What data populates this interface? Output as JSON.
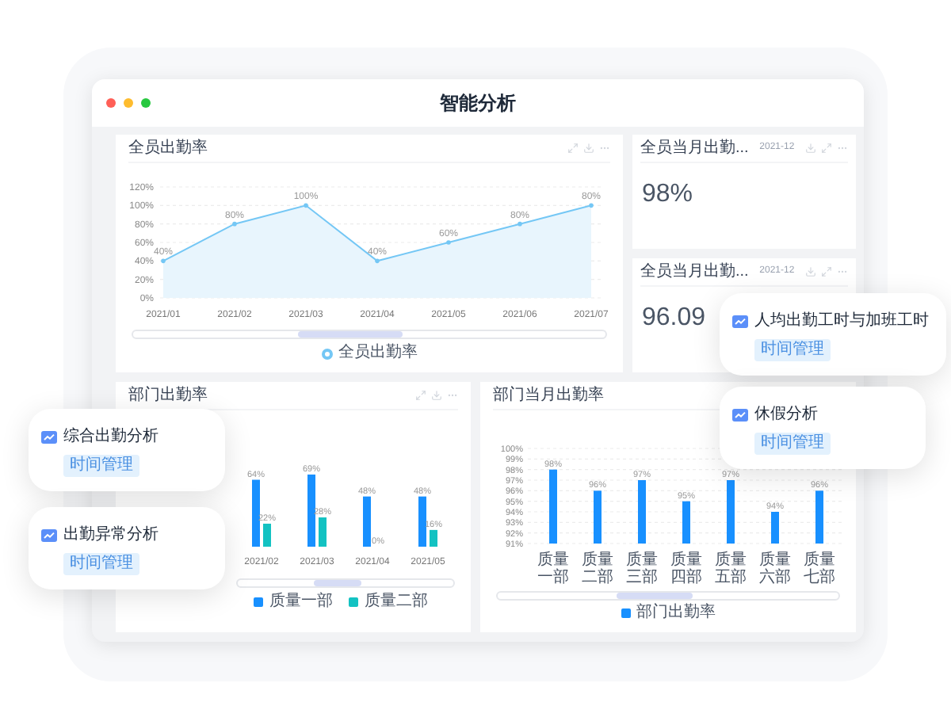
{
  "window": {
    "title": "智能分析"
  },
  "attendance_trend": {
    "title": "全员出勤率",
    "chart_data": {
      "type": "area",
      "categories": [
        "2021/01",
        "2021/02",
        "2021/03",
        "2021/04",
        "2021/05",
        "2021/06",
        "2021/07"
      ],
      "series": [
        {
          "name": "全员出勤率",
          "color": "#74c7f5",
          "values": [
            40,
            80,
            100,
            40,
            60,
            80,
            100
          ]
        }
      ],
      "ylim": [
        0,
        120
      ],
      "yticks": [
        {
          "value": 0,
          "label": "0%"
        },
        {
          "value": 20,
          "label": "20%"
        },
        {
          "value": 40,
          "label": "40%"
        },
        {
          "value": 60,
          "label": "60%"
        },
        {
          "value": 80,
          "label": "80%"
        },
        {
          "value": 100,
          "label": "100%"
        },
        {
          "value": 120,
          "label": "120%"
        }
      ],
      "value_labels": [
        "40%",
        "80%",
        "100%",
        "40%",
        "60%",
        "80%",
        "80%"
      ],
      "grid": true,
      "legend": "bottom"
    }
  },
  "monthly_cards": [
    {
      "title": "全员当月出勤...",
      "date": "2021-12",
      "value": "98%"
    },
    {
      "title": "全员当月出勤...",
      "date": "2021-12",
      "value": "96.09"
    }
  ],
  "department_chart": {
    "title": "部门出勤率",
    "chart_data": {
      "type": "bar",
      "categories": [
        "2021/02",
        "2021/03",
        "2021/04",
        "2021/05"
      ],
      "series": [
        {
          "name": "质量一部",
          "color": "#1890ff",
          "values": [
            64,
            69,
            48,
            48
          ],
          "value_labels": [
            "64%",
            "69%",
            "48%",
            "48%"
          ]
        },
        {
          "name": "质量二部",
          "color": "#13c2c2",
          "values": [
            22,
            28,
            0,
            16
          ],
          "value_labels": [
            "22%",
            "28%",
            "0%",
            "16%"
          ]
        }
      ],
      "legend": "bottom"
    }
  },
  "department_month_chart": {
    "title": "部门当月出勤率",
    "chart_data": {
      "type": "bar",
      "categories": [
        "质量一部",
        "质量二部",
        "质量三部",
        "质量四部",
        "质量五部",
        "质量六部",
        "质量七部"
      ],
      "series": [
        {
          "name": "部门出勤率",
          "color": "#1890ff",
          "values": [
            98,
            96,
            97,
            95,
            97,
            94,
            96
          ]
        }
      ],
      "ylim": [
        91,
        100
      ],
      "yticks": [
        {
          "value": 91,
          "label": "91%"
        },
        {
          "value": 92,
          "label": "92%"
        },
        {
          "value": 93,
          "label": "93%"
        },
        {
          "value": 94,
          "label": "94%"
        },
        {
          "value": 95,
          "label": "95%"
        },
        {
          "value": 96,
          "label": "96%"
        },
        {
          "value": 97,
          "label": "97%"
        },
        {
          "value": 98,
          "label": "98%"
        },
        {
          "value": 99,
          "label": "99%"
        },
        {
          "value": 100,
          "label": "100%"
        }
      ],
      "value_labels": [
        "98%",
        "96%",
        "97%",
        "95%",
        "97%",
        "94%",
        "96%"
      ],
      "grid": true,
      "legend": "bottom"
    }
  },
  "report_cards": [
    {
      "title": "人均出勤工时与加班工时",
      "tag": "时间管理"
    },
    {
      "title": "休假分析",
      "tag": "时间管理"
    },
    {
      "title": "综合出勤分析",
      "tag": "时间管理"
    },
    {
      "title": "出勤异常分析",
      "tag": "时间管理"
    }
  ]
}
